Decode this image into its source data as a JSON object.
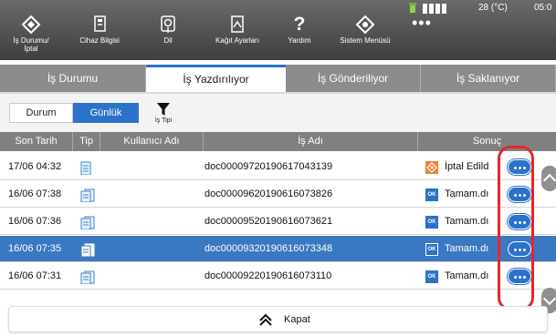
{
  "status_bar": {
    "temperature": "28 (°C)",
    "time": "05:0"
  },
  "nav": {
    "items": [
      {
        "label": "İş Durumu/\nİptal"
      },
      {
        "label": "Cihaz Bilgisi"
      },
      {
        "label": "Dil"
      },
      {
        "label": "Kağıt Ayarları"
      },
      {
        "label": "Yardım"
      },
      {
        "label": "Sistem Menüsü"
      }
    ],
    "more": "•••"
  },
  "tabs": [
    "İş Durumu",
    "İş Yazdırılıyor",
    "İş Gönderiliyor",
    "İş Saklanıyor"
  ],
  "filter": {
    "status_label": "Durum",
    "daily_label": "Günlük",
    "job_type_label": "İş Tipi"
  },
  "table": {
    "headers": [
      "Son Tarih",
      "Tip",
      "Kullanıcı Adı",
      "İş Adı",
      "Sonuç"
    ],
    "rows": [
      {
        "date": "17/06 04:32",
        "job": "doc00009720190617043139",
        "result": "İptal Edild"
      },
      {
        "date": "16/06 07:38",
        "job": "doc00009620190616073826",
        "result": "Tamam.dı"
      },
      {
        "date": "16/06 07:36",
        "job": "doc00009520190616073621",
        "result": "Tamam.dı"
      },
      {
        "date": "16/06 07:35",
        "job": "doc00009320190616073348",
        "result": "Tamam.dı"
      },
      {
        "date": "16/06 07:31",
        "job": "doc00009220190616073110",
        "result": "Tamam.dı"
      }
    ],
    "ok_badge": "OK"
  },
  "footer": {
    "close_label": "Kapat"
  },
  "colors": {
    "accent": "#2b73c9",
    "selected_row": "#3b78c2",
    "highlight": "#e8262a",
    "cancel_badge": "#f0813a"
  }
}
